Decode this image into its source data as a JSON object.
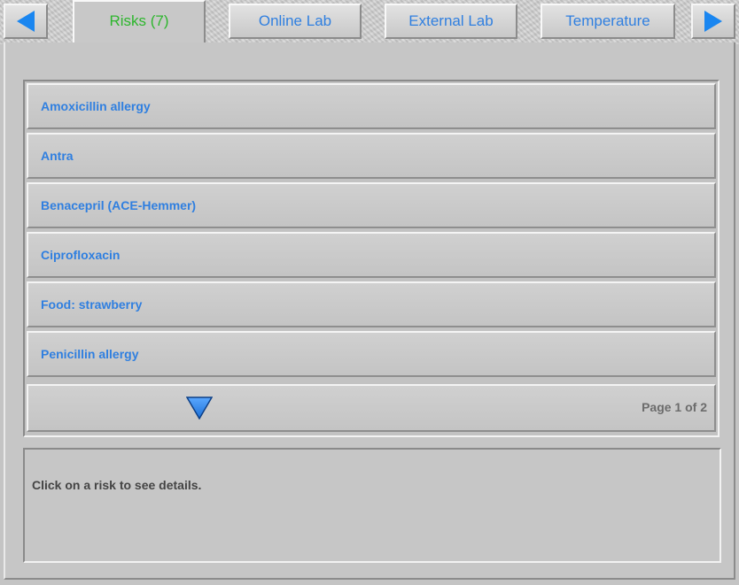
{
  "tabs": [
    {
      "label": "Risks (7)",
      "active": true
    },
    {
      "label": "Online Lab",
      "active": false
    },
    {
      "label": "External Lab",
      "active": false
    },
    {
      "label": "Temperature",
      "active": false
    }
  ],
  "nav": {
    "prev_icon": "triangle-left-icon",
    "next_icon": "triangle-right-icon"
  },
  "risks": {
    "items": [
      {
        "label": "Amoxicillin allergy"
      },
      {
        "label": "Antra"
      },
      {
        "label": "Benacepril (ACE-Hemmer)"
      },
      {
        "label": "Ciprofloxacin"
      },
      {
        "label": "Food: strawberry"
      },
      {
        "label": "Penicillin allergy"
      }
    ],
    "page_label": "Page 1 of 2",
    "scroll_down_icon": "triangle-down-icon"
  },
  "details": {
    "hint": "Click on a risk to see details."
  },
  "colors": {
    "link": "#2f7fe0",
    "active_tab": "#2db62d",
    "arrow": "#1a86f0",
    "muted": "#6c6c6c"
  }
}
